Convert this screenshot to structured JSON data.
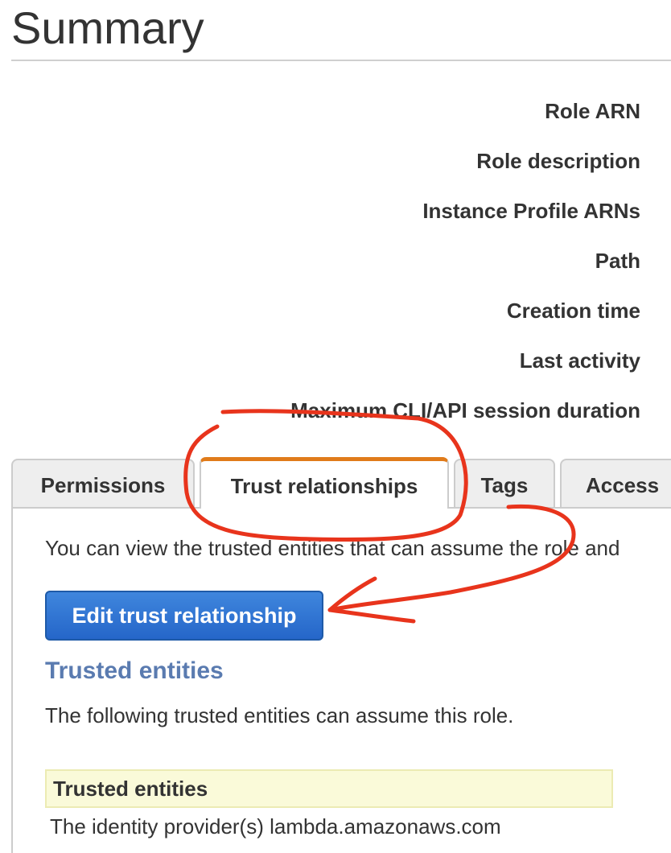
{
  "page": {
    "title": "Summary"
  },
  "summary": {
    "labels": [
      "Role ARN",
      "Role description",
      "Instance Profile ARNs",
      "Path",
      "Creation time",
      "Last activity",
      "Maximum CLI/API session duration"
    ]
  },
  "tabs": [
    {
      "label": "Permissions",
      "active": false
    },
    {
      "label": "Trust relationships",
      "active": true
    },
    {
      "label": "Tags",
      "active": false
    },
    {
      "label": "Access",
      "active": false
    }
  ],
  "trust_panel": {
    "intro": "You can view the trusted entities that can assume the role and",
    "edit_button_label": "Edit trust relationship",
    "section_heading": "Trusted entities",
    "section_description": "The following trusted entities can assume this role.",
    "table": {
      "header": "Trusted entities",
      "rows": [
        "The identity provider(s) lambda.amazonaws.com"
      ]
    }
  },
  "colors": {
    "active_tab_accent": "#e07b1a",
    "primary_button": "#2f74d0",
    "section_heading": "#5a7bb0",
    "table_header_bg": "#fafad9",
    "annotation_ink": "#e8341c"
  }
}
